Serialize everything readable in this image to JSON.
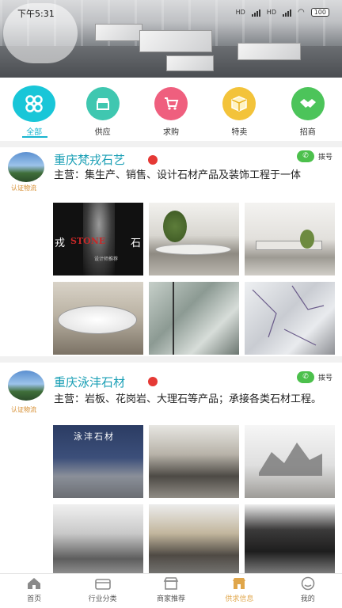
{
  "status_bar": {
    "time": "下午5:31",
    "network_1": "HD",
    "network_2": "HD",
    "battery": "100"
  },
  "categories": [
    {
      "label": "全部",
      "icon": "grid-icon",
      "color": "#19c6d8",
      "active": true
    },
    {
      "label": "供应",
      "icon": "shop-icon",
      "color": "#3fc7b0"
    },
    {
      "label": "求购",
      "icon": "cart-icon",
      "color": "#ef5f7e"
    },
    {
      "label": "特卖",
      "icon": "box-icon",
      "color": "#f3c33a"
    },
    {
      "label": "招商",
      "icon": "handshake-icon",
      "color": "#4cc45a"
    }
  ],
  "companies": [
    {
      "name": "重庆梵戎石艺",
      "cert": "认证物流",
      "dial_label": "拨号",
      "main": "主营：集生产、销售、设计石材产品及装饰工程于一体",
      "photo_text": {
        "left": "戎",
        "stone": "STONE",
        "right": "石",
        "sub": "设计师推荐"
      }
    },
    {
      "name": "重庆泳沣石材",
      "cert": "认证物流",
      "dial_label": "拨号",
      "main": "主营：岩板、花岗岩、大理石等产品；承接各类石材工程。",
      "photo_text": {
        "sign": "泳沣石材"
      }
    }
  ],
  "tabs": [
    {
      "label": "首页",
      "icon": "home-icon"
    },
    {
      "label": "行业分类",
      "icon": "category-icon"
    },
    {
      "label": "商家推荐",
      "icon": "store-icon"
    },
    {
      "label": "供求信息",
      "icon": "supply-icon",
      "active": true
    },
    {
      "label": "我的",
      "icon": "profile-icon"
    }
  ],
  "colors": {
    "accent": "#19b4cf",
    "tab_active": "#e0a64a",
    "badge": "#e53935",
    "dial": "#4cc04c"
  }
}
